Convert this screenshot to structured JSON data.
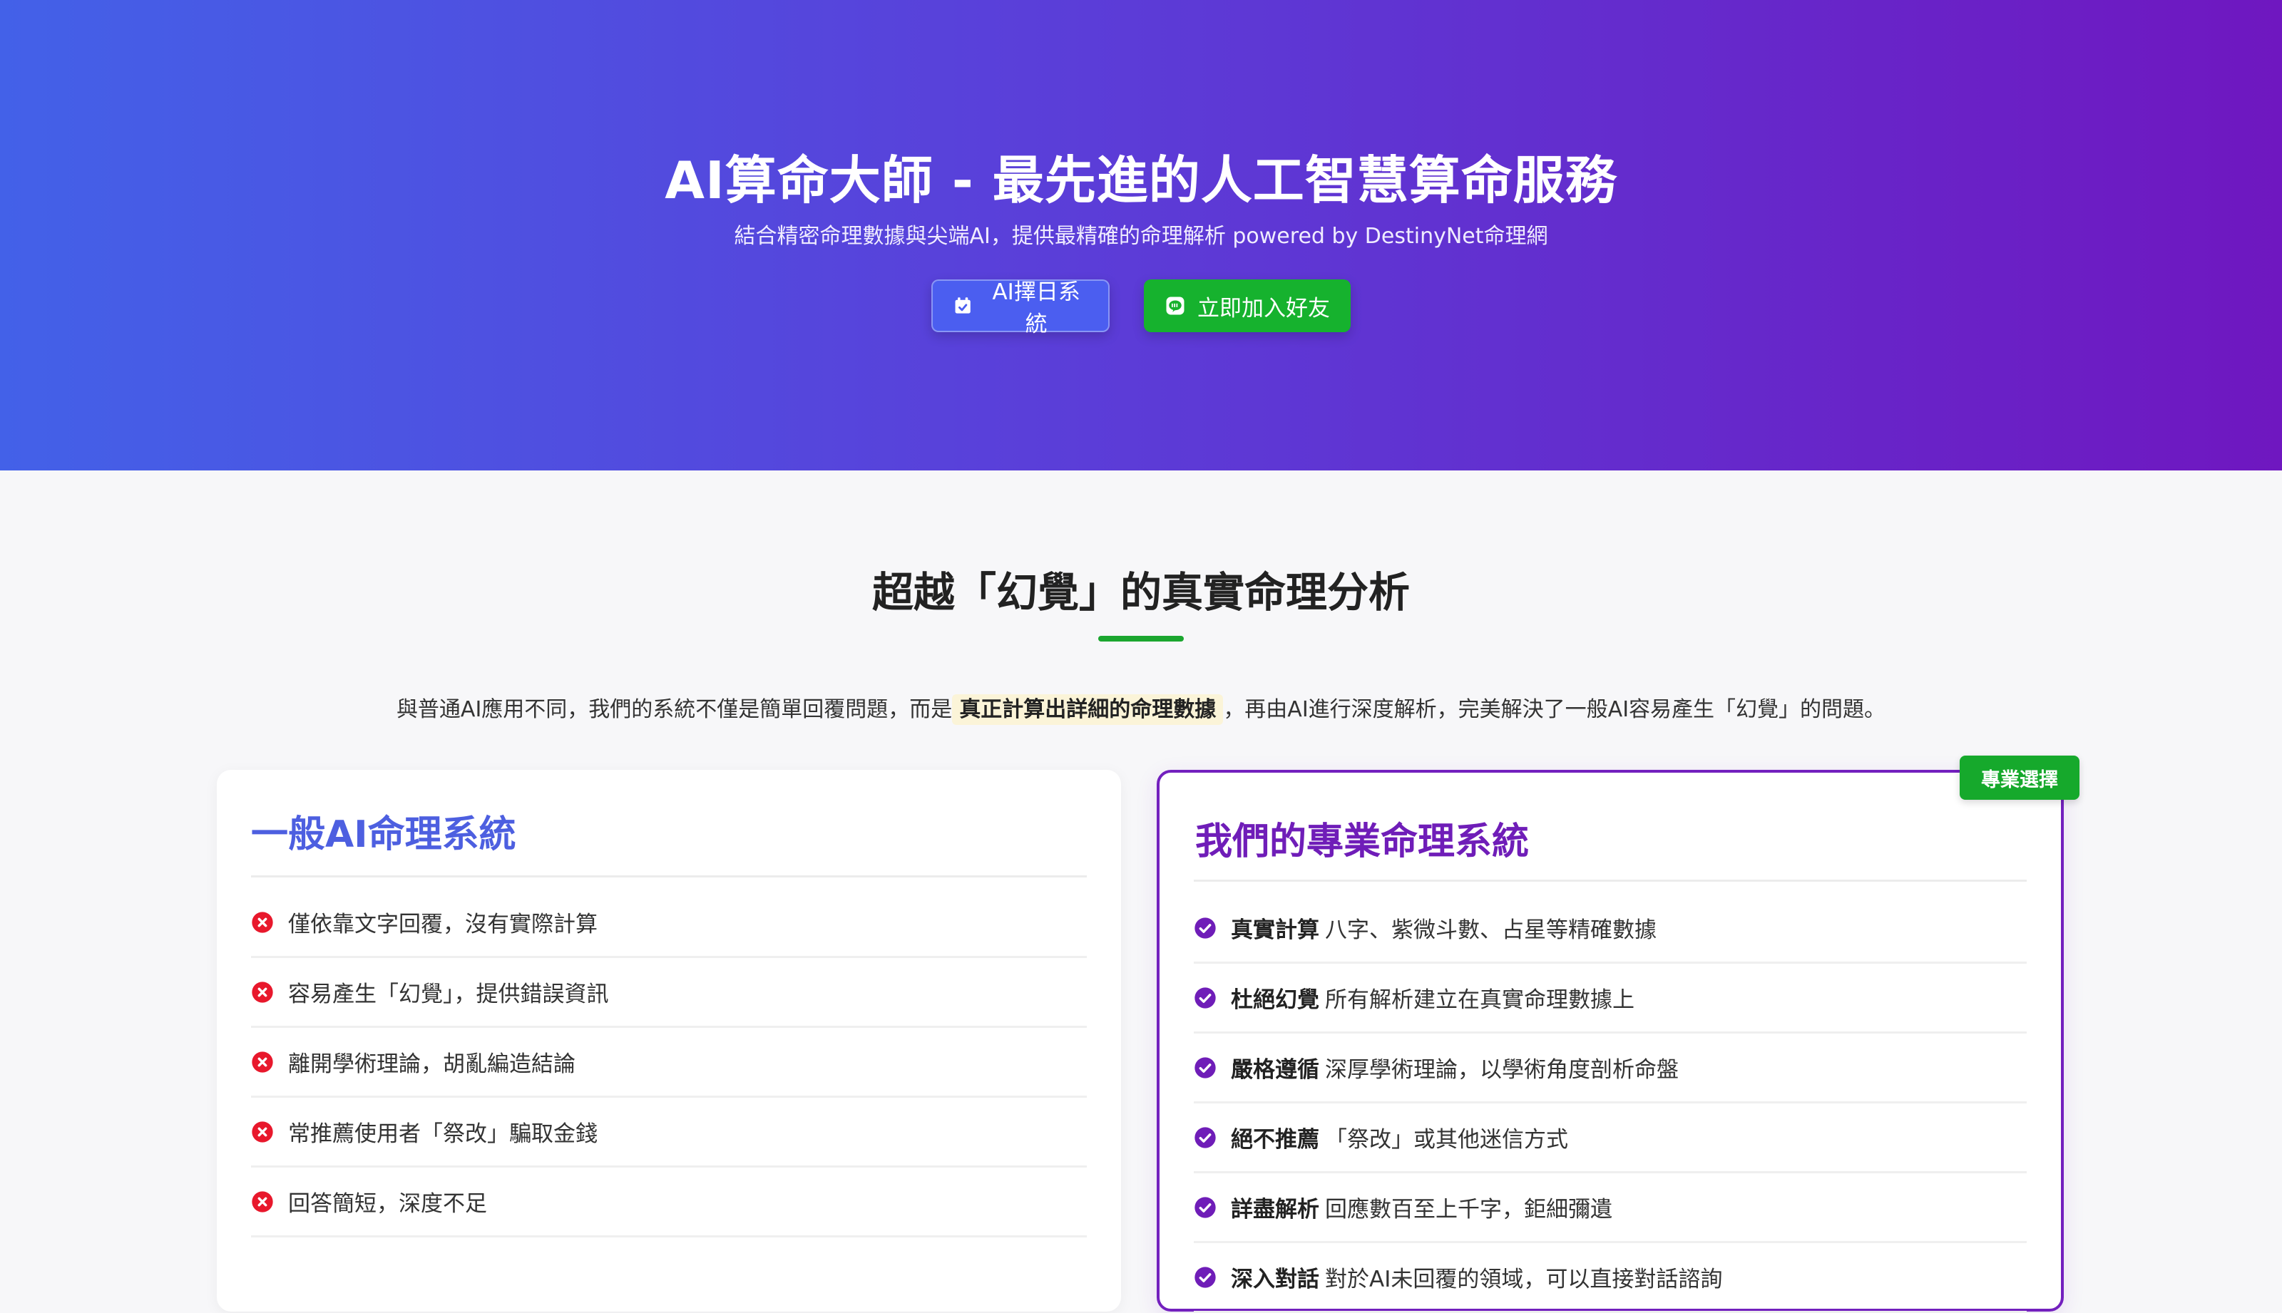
{
  "hero": {
    "title": "AI算命大師 - 最先進的人工智慧算命服務",
    "subtitle": "結合精密命理數據與尖端AI，提供最精確的命理解析 powered by DestinyNet命理網",
    "buttons": {
      "calendar_label": "AI擇日系統",
      "line_label": "立即加入好友"
    }
  },
  "section": {
    "title": "超越「幻覺」的真實命理分析",
    "intro_before": "與普通AI應用不同，我們的系統不僅是簡單回覆問題，而是",
    "intro_highlight": "真正計算出詳細的命理數據",
    "intro_after": "，再由AI進行深度解析，完美解決了一般AI容易產生「幻覺」的問題。"
  },
  "general_card": {
    "title": "一般AI命理系統",
    "items": [
      "僅依靠文字回覆，沒有實際計算",
      "容易產生「幻覺」，提供錯誤資訊",
      "離開學術理論，胡亂編造結論",
      "常推薦使用者「祭改」騙取金錢",
      "回答簡短，深度不足"
    ]
  },
  "pro_card": {
    "badge": "專業選擇",
    "title": "我們的專業命理系統",
    "items": [
      {
        "label": "真實計算",
        "text": "八字、紫微斗數、占星等精確數據"
      },
      {
        "label": "杜絕幻覺",
        "text": "所有解析建立在真實命理數據上"
      },
      {
        "label": "嚴格遵循",
        "text": "深厚學術理論，以學術角度剖析命盤"
      },
      {
        "label": "絕不推薦",
        "text": "「祭改」或其他迷信方式"
      },
      {
        "label": "詳盡解析",
        "text": "回應數百至上千字，鉅細彌遺"
      },
      {
        "label": "深入對話",
        "text": "對於AI未回覆的領域，可以直接對話諮詢"
      }
    ]
  },
  "colors": {
    "hero_gradient_start": "#4361e8",
    "hero_gradient_end": "#6f17c0",
    "accent_green": "#16b22e",
    "general_title": "#4d5fe0",
    "pro_title": "#6f1db8",
    "cross_red": "#e8182c",
    "check_purple": "#6f1db8"
  },
  "icons": {
    "calendar": "calendar-check-icon",
    "line": "line-chat-icon",
    "cross": "x-circle-icon",
    "check": "check-circle-icon"
  }
}
